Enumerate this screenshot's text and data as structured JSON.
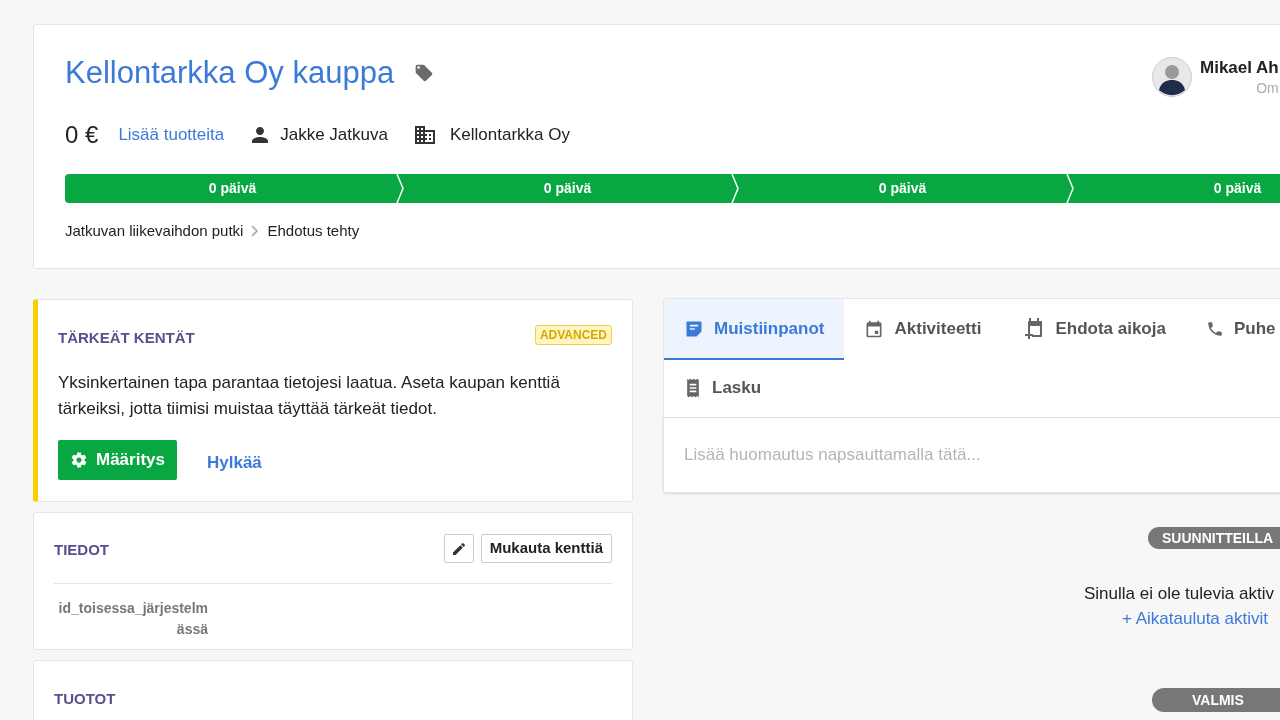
{
  "deal": {
    "title": "Kellontarkka Oy kauppa",
    "value": "0 €",
    "add_products_link": "Lisää tuotteita",
    "person": "Jakke Jatkuva",
    "organization": "Kellontarkka Oy",
    "owner": {
      "name": "Mikael Ah",
      "role": "Om"
    },
    "stages": [
      {
        "label": "0 päivä"
      },
      {
        "label": "0 päivä"
      },
      {
        "label": "0 päivä"
      },
      {
        "label": "0 päivä"
      }
    ],
    "breadcrumb": [
      "Jatkuvan liikevaihdon putki",
      "Ehdotus tehty"
    ]
  },
  "important_fields": {
    "title": "TÄRKEÄT KENTÄT",
    "badge": "ADVANCED",
    "text": "Yksinkertainen tapa parantaa tietojesi laatua. Aseta kaupan kenttiä tärkeiksi, jotta tiimisi muistaa täyttää tärkeät tiedot.",
    "primary_button": "Määritys",
    "dismiss_link": "Hylkää"
  },
  "details": {
    "title": "TIEDOT",
    "customize_button": "Mukauta kenttiä",
    "field_label": "id_toisessa_järjestelmässä"
  },
  "products": {
    "title": "TUOTOT"
  },
  "tabs": [
    {
      "label": "Muistiinpanot",
      "kind": "note",
      "selected": true
    },
    {
      "label": "Aktiviteetti",
      "kind": "calendar",
      "selected": false
    },
    {
      "label": "Ehdota aikoja",
      "kind": "schedule",
      "selected": false
    },
    {
      "label": "Puhe",
      "kind": "phone",
      "selected": false
    },
    {
      "label": "Lasku",
      "kind": "invoice",
      "selected": false
    }
  ],
  "note_placeholder": "Lisää huomautus napsauttamalla tätä...",
  "timeline": {
    "planned_badge": "SUUNNITTEILLA",
    "empty_text": "Sinulla ei ole tulevia aktiv",
    "schedule_link": "+ Aikatauluta aktivit",
    "done_badge": "VALMIS"
  }
}
